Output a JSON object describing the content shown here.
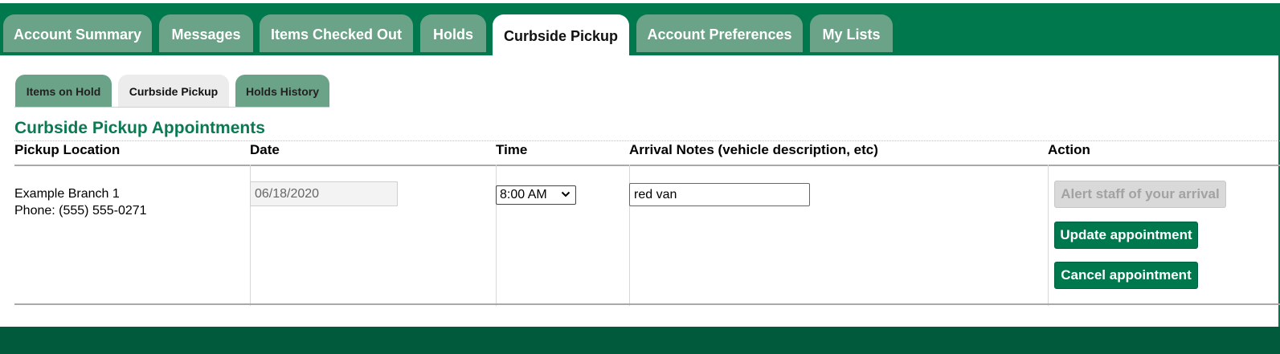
{
  "main_tabs": [
    {
      "label": "Account Summary"
    },
    {
      "label": "Messages"
    },
    {
      "label": "Items Checked Out"
    },
    {
      "label": "Holds"
    },
    {
      "label": "Curbside Pickup",
      "active": true
    },
    {
      "label": "Account Preferences"
    },
    {
      "label": "My Lists"
    }
  ],
  "sub_tabs": [
    {
      "label": "Items on Hold"
    },
    {
      "label": "Curbside Pickup",
      "active": true
    },
    {
      "label": "Holds History"
    }
  ],
  "section": {
    "title": "Curbside Pickup Appointments"
  },
  "table": {
    "headers": {
      "location": "Pickup Location",
      "date": "Date",
      "time": "Time",
      "notes": "Arrival Notes (vehicle description, etc)",
      "action": "Action"
    },
    "row": {
      "location_name": "Example Branch 1",
      "location_phone": "Phone: (555) 555-0271",
      "date": "06/18/2020",
      "time": "8:00 AM",
      "notes": "red van",
      "actions": {
        "alert": "Alert staff of your arrival",
        "update": "Update appointment",
        "cancel": "Cancel appointment"
      }
    }
  },
  "colors": {
    "brand": "#00784e",
    "tab_inactive": "#6aa387",
    "footer": "#005a3b"
  }
}
